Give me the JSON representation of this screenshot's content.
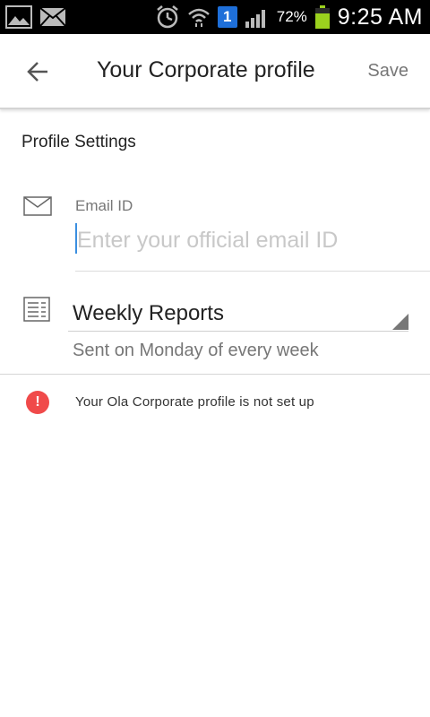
{
  "status_bar": {
    "left_icons": [
      "image-icon",
      "mail-icon"
    ],
    "right_icons": [
      "alarm-icon",
      "wifi-icon",
      "sim-icon",
      "signal-icon",
      "battery-icon"
    ],
    "sim_badge": "1",
    "battery_percent": "72%",
    "time": "9:25 AM",
    "battery_color": "#9bd11e"
  },
  "app_bar": {
    "back_icon": "back-arrow-icon",
    "title": "Your Corporate profile",
    "save_label": "Save"
  },
  "profile": {
    "section_title": "Profile Settings",
    "email": {
      "icon": "envelope-icon",
      "label": "Email ID",
      "value": "",
      "placeholder": "Enter your official email ID"
    },
    "reports": {
      "icon": "report-icon",
      "selected": "Weekly Reports",
      "subtitle": "Sent on Monday of every week"
    }
  },
  "notice": {
    "icon": "alert-icon",
    "icon_glyph": "!",
    "text": "Your Ola Corporate profile is not set up",
    "color": "#f04a4a"
  },
  "colors": {
    "accent": "#3b8fe0",
    "status_bar_bg": "#000000"
  }
}
